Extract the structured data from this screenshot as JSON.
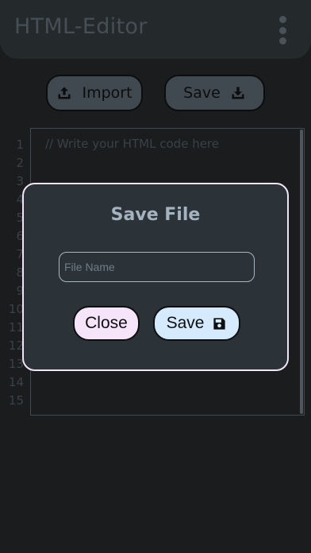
{
  "header": {
    "title": "HTML-Editor",
    "menu_icon": "more-vert-icon"
  },
  "toolbar": {
    "import_label": "Import",
    "import_icon": "upload-icon",
    "save_label": "Save",
    "save_icon": "download-icon"
  },
  "editor": {
    "placeholder": "// Write your HTML code here",
    "line_numbers": [
      "1",
      "2",
      "3",
      "4",
      "5",
      "6",
      "7",
      "8",
      "9",
      "10",
      "11",
      "12",
      "13",
      "14",
      "15"
    ]
  },
  "dialog": {
    "title": "Save File",
    "input_placeholder": "File Name",
    "input_value": "",
    "close_label": "Close",
    "save_label": "Save",
    "save_icon": "floppy-disk-icon"
  },
  "colors": {
    "background": "#1e2022",
    "header": "#2a2f33",
    "toolbar_button": "#4a545c",
    "dialog_bg": "#2b3339",
    "dialog_border": "#f2e4f6",
    "close_button": "#f6e4fb",
    "save_button": "#d6eafd"
  }
}
